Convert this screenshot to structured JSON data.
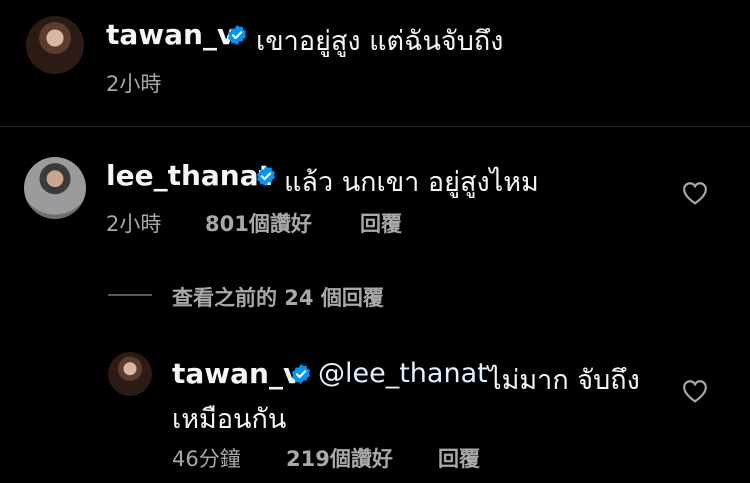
{
  "caption": {
    "username": "tawan_v",
    "text": "เขาอยู่สูง แต่ฉันจับถึง",
    "time": "2小時"
  },
  "comment": {
    "username": "lee_thanat",
    "text": "แล้ว นกเขา อยู่สูงไหม",
    "time": "2小時",
    "likes": "801個讚好",
    "reply_label": "回覆"
  },
  "view_replies": "查看之前的 24 個回覆",
  "reply": {
    "username": "tawan_v",
    "mention": "@lee_thanat",
    "text_line1": "ไม่มาก จับถึง",
    "text_line2": "เหมือนกัน",
    "time": "46分鐘",
    "likes": "219個讚好",
    "reply_label": "回覆"
  },
  "colors": {
    "background": "#000000",
    "text": "#f5f5f5",
    "secondary": "#a8a8a8",
    "mention": "#e0f1ff",
    "verified": "#0095f6"
  },
  "icons": [
    "verified-badge-icon",
    "heart-icon"
  ]
}
